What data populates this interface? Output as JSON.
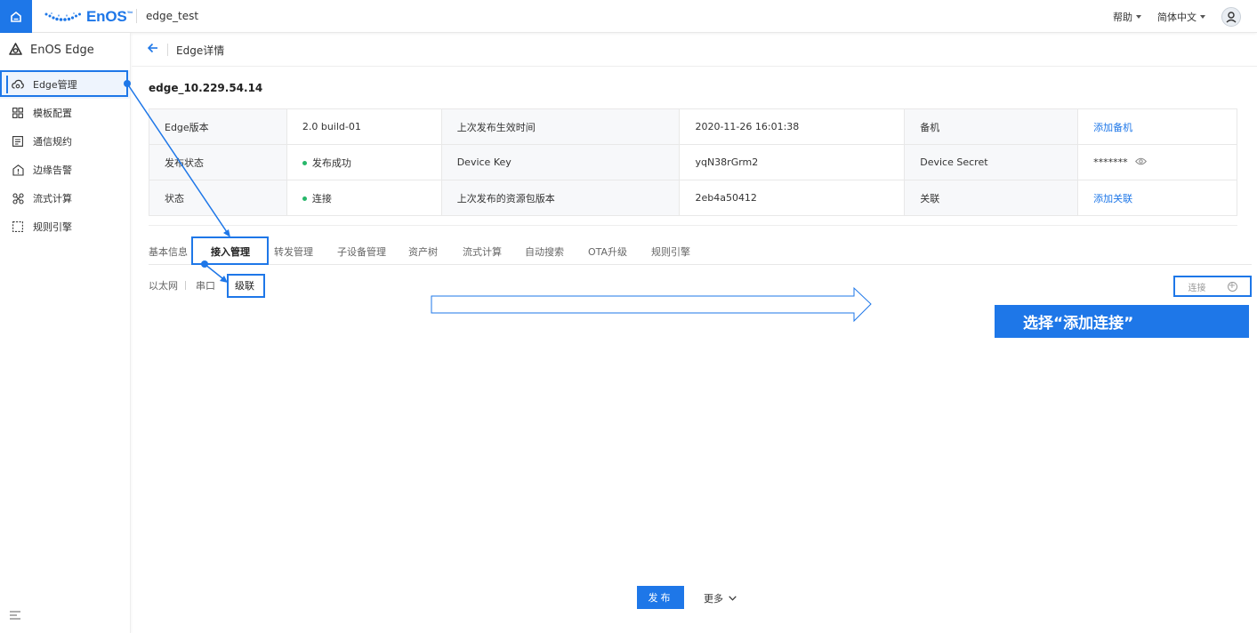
{
  "topbar": {
    "brand": "EnOS",
    "brand_tm": "™",
    "app_name": "edge_test",
    "help_label": "帮助",
    "lang_label": "简体中文"
  },
  "sidebar": {
    "title": "EnOS Edge",
    "items": [
      {
        "label": "Edge管理",
        "icon": "cloud-gear-icon",
        "active": true
      },
      {
        "label": "模板配置",
        "icon": "grid-icon"
      },
      {
        "label": "通信规约",
        "icon": "document-icon"
      },
      {
        "label": "边缘告警",
        "icon": "alarm-icon"
      },
      {
        "label": "流式计算",
        "icon": "stream-icon"
      },
      {
        "label": "规则引擎",
        "icon": "rule-icon"
      }
    ]
  },
  "header": {
    "title": "Edge详情"
  },
  "device": {
    "name": "edge_10.229.54.14",
    "rows": [
      [
        {
          "label": "Edge版本",
          "value": "2.0 build-01"
        },
        {
          "label": "上次发布生效时间",
          "value": "2020-11-26 16:01:38"
        },
        {
          "label": "备机",
          "value": "添加备机"
        }
      ],
      [
        {
          "label": "发布状态",
          "value": "发布成功"
        },
        {
          "label": "Device Key",
          "value": "yqN38rGrm2"
        },
        {
          "label": "Device Secret",
          "value": "*******"
        }
      ],
      [
        {
          "label": "状态",
          "value": "连接"
        },
        {
          "label": "上次发布的资源包版本",
          "value": "2eb4a50412"
        },
        {
          "label": "关联",
          "value": "添加关联"
        }
      ]
    ]
  },
  "tabs": [
    "基本信息",
    "接入管理",
    "转发管理",
    "子设备管理",
    "资产树",
    "流式计算",
    "自动搜索",
    "OTA升级",
    "规则引擎"
  ],
  "active_tab": "接入管理",
  "subtabs": [
    "以太网",
    "串口",
    "级联"
  ],
  "active_subtab": "级联",
  "add_connection_label": "连接",
  "annotation": "选择“添加连接”",
  "footer": {
    "publish": "发布",
    "more": "更多"
  },
  "colors": {
    "accent": "#1e77e8",
    "success": "#27b76a"
  }
}
